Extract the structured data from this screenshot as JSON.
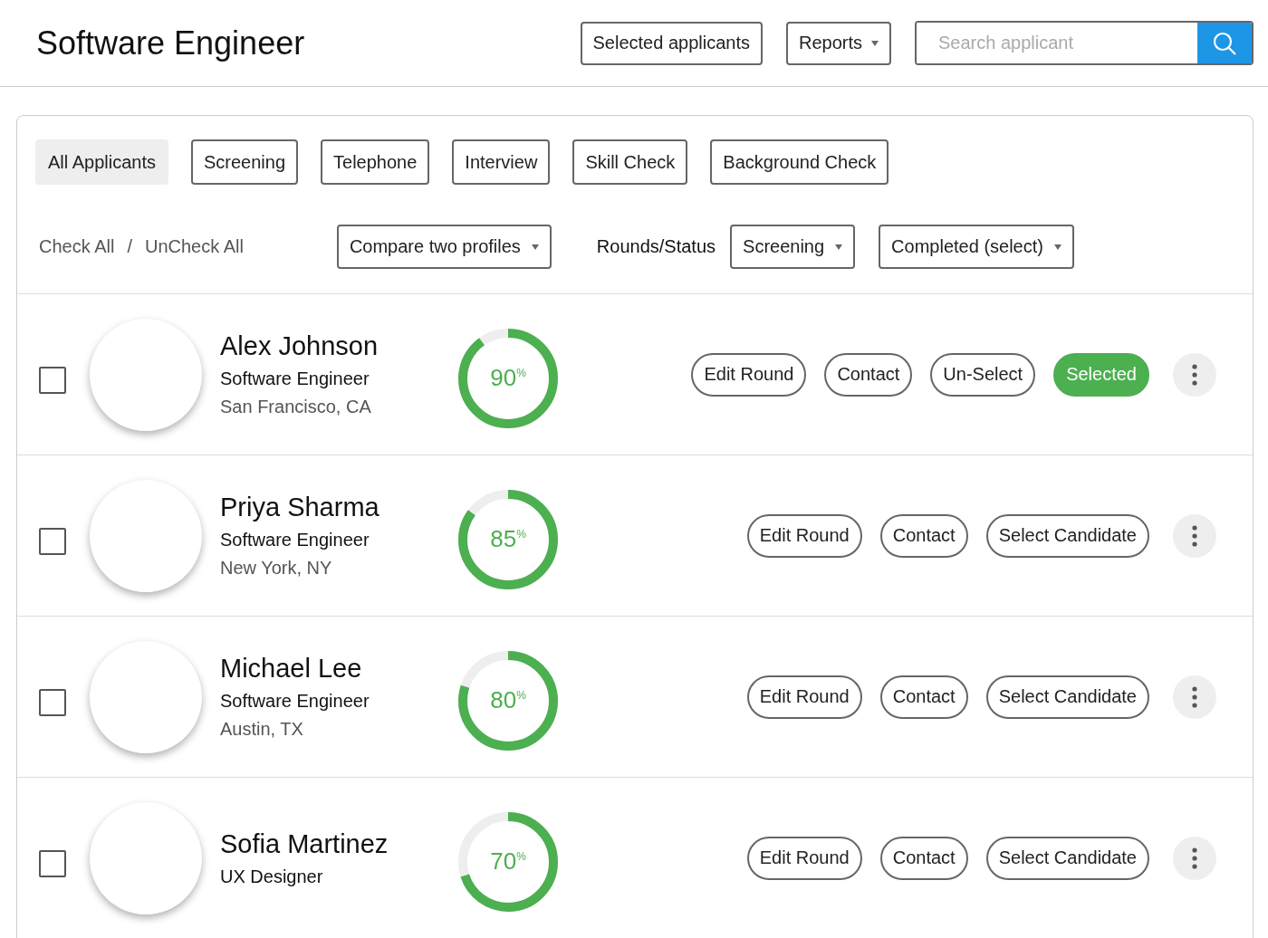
{
  "header": {
    "title": "Software Engineer",
    "buttons": [
      {
        "label": "Selected applicants",
        "kind": "plain"
      },
      {
        "label": "Reports",
        "kind": "dropdown"
      }
    ],
    "search": {
      "placeholder": "Search applicant"
    }
  },
  "tabs": [
    {
      "label": "All Applicants",
      "selected": true
    },
    {
      "label": "Screening",
      "selected": false
    },
    {
      "label": "Telephone",
      "selected": false
    },
    {
      "label": "Interview",
      "selected": false
    },
    {
      "label": "Skill Check",
      "selected": false
    },
    {
      "label": "Background Check",
      "selected": false
    }
  ],
  "toolbar": {
    "check_all": "Check All",
    "separator": "/",
    "uncheck_all": "UnCheck All",
    "compare": "Compare two profiles",
    "rounds_label": "Rounds/Status",
    "round": "Screening",
    "status": "Completed (select)"
  },
  "applicants": [
    {
      "name": "Alex Johnson",
      "role": "Software Engineer",
      "location": "San Francisco, CA",
      "checked": false,
      "score": "90",
      "percent": "%",
      "level": 0.9,
      "actions": [
        {
          "label": "Edit Round",
          "kind": "outline"
        },
        {
          "label": "Contact",
          "kind": "outline"
        },
        {
          "label": "Un-Select",
          "kind": "outline"
        },
        {
          "label": "Selected",
          "kind": "filled"
        }
      ]
    },
    {
      "name": "Priya Sharma",
      "role": "Software Engineer",
      "location": "New York, NY",
      "checked": false,
      "score": "85",
      "percent": "%",
      "level": 0.85,
      "actions": [
        {
          "label": "Edit Round",
          "kind": "outline"
        },
        {
          "label": "Contact",
          "kind": "outline"
        },
        {
          "label": "Select Candidate",
          "kind": "outline"
        }
      ]
    },
    {
      "name": "Michael Lee",
      "role": "Software Engineer",
      "location": "Austin, TX",
      "checked": false,
      "score": "80",
      "percent": "%",
      "level": 0.8,
      "actions": [
        {
          "label": "Edit Round",
          "kind": "outline"
        },
        {
          "label": "Contact",
          "kind": "outline"
        },
        {
          "label": "Select Candidate",
          "kind": "outline"
        }
      ]
    },
    {
      "name": "Sofia Martinez",
      "role": "UX Designer",
      "checked": false,
      "score": "70",
      "percent": "%",
      "level": 0.7,
      "actions": [
        {
          "label": "Edit Round",
          "kind": "outline"
        },
        {
          "label": "Contact",
          "kind": "outline"
        },
        {
          "label": "Select Candidate",
          "kind": "outline"
        }
      ]
    }
  ]
}
